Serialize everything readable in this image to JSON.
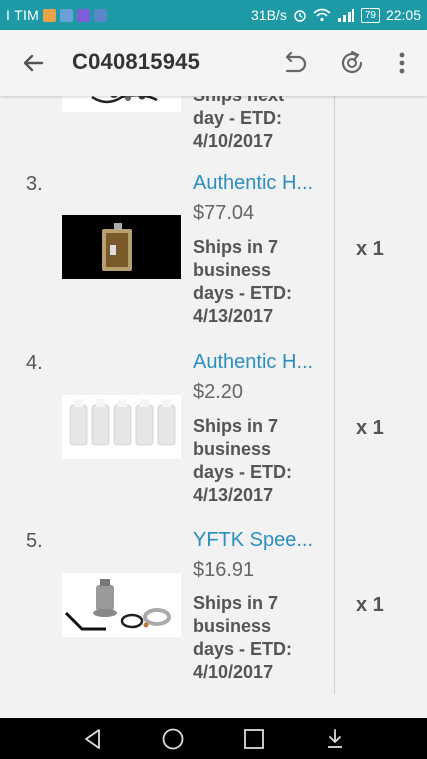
{
  "status_bar": {
    "carrier": "I TIM",
    "speed": "31B/s",
    "battery": "79",
    "time": "22:05"
  },
  "toolbar": {
    "title": "C040815945",
    "back_icon": "arrow-left-icon",
    "undo_icon": "undo-icon",
    "refresh_icon": "refresh-icon",
    "menu_icon": "more-vert-icon"
  },
  "partial_item": {
    "ship_lines": [
      "Ships next",
      "day - ETD:",
      "4/10/2017"
    ]
  },
  "items": [
    {
      "number": "3.",
      "name": "Authentic H...",
      "price": "$77.04",
      "ship_lines": [
        "Ships in 7",
        "business",
        "days - ETD:",
        "4/13/2017"
      ],
      "qty": "x 1"
    },
    {
      "number": "4.",
      "name": "Authentic H...",
      "price": "$2.20",
      "ship_lines": [
        "Ships in 7",
        "business",
        "days - ETD:",
        "4/13/2017"
      ],
      "qty": "x 1"
    },
    {
      "number": "5.",
      "name": "YFTK Spee...",
      "price": "$16.91",
      "ship_lines": [
        "Ships in 7",
        "business",
        "days - ETD:",
        "4/10/2017"
      ],
      "qty": "x 1"
    }
  ],
  "colors": {
    "status_bar": "#1d9aa6",
    "link": "#2a8fbf",
    "text": "#555555"
  }
}
